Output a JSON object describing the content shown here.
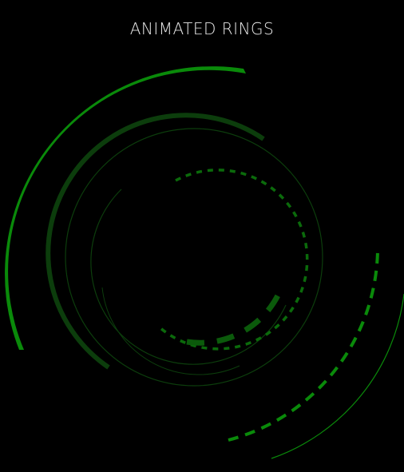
{
  "title": "ANIMATED RINGS",
  "colors": {
    "background": "#000000",
    "title": "#e8e8e8",
    "ring_bright": "#0a8a0a",
    "ring_mid": "#0b6a0b",
    "ring_dark": "#0c3d0c"
  }
}
